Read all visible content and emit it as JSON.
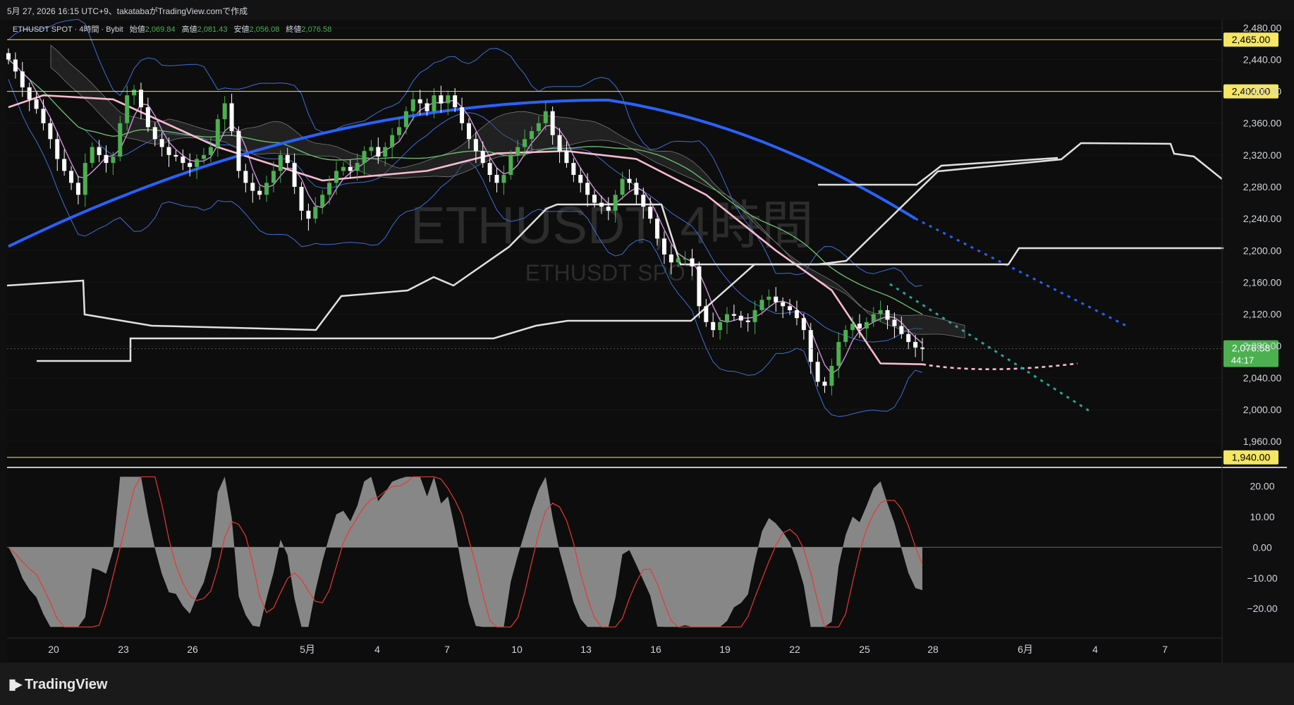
{
  "header": {
    "caption": "5月 27, 2026 16:15 UTC+9、takatabaがTradingView.comで作成"
  },
  "legend": {
    "symbol": "ETHUSDT SPOT · 4時間 · Bybit",
    "open_label": "始値",
    "open_value": "2,069.84",
    "high_label": "高値",
    "high_value": "2,081.43",
    "low_label": "安値",
    "low_value": "2,056.08",
    "close_label": "終値",
    "close_value": "2,076.58"
  },
  "watermark": {
    "title": "ETHUSDT, 4時間",
    "subtitle": "ETHUSDT SPOT"
  },
  "footer": {
    "brand": "TradingView"
  },
  "colors": {
    "up": "#26a69a",
    "up_bright": "#4caf50",
    "down": "#ffffff",
    "ma_blue": "#2962ff",
    "ma_pink": "#f8bbd0",
    "ma_green": "#66bb6a",
    "ma_purple": "#ce93d8",
    "bollinger": "#3d6fd6",
    "ichimoku": "#e0e0e0",
    "level_line": "#f5e663",
    "price_tag": "#4caf50",
    "oscillator": "#9e9e9e",
    "signal": "#e53935"
  },
  "chart_data": [
    {
      "type": "candlestick",
      "pane": "price",
      "ylim": [
        1930,
        2490
      ],
      "y_ticks": [
        "2,480.00",
        "2,440.00",
        "2,400.00",
        "2,360.00",
        "2,320.00",
        "2,280.00",
        "2,240.00",
        "2,200.00",
        "2,160.00",
        "2,120.00",
        "2,080.00",
        "2,040.00",
        "2,000.00",
        "1,960.00"
      ],
      "y_tick_values": [
        2480,
        2440,
        2400,
        2360,
        2320,
        2280,
        2240,
        2200,
        2160,
        2120,
        2080,
        2040,
        2000,
        1960
      ],
      "x_ticks": [
        "20",
        "23",
        "26",
        "5月",
        "4",
        "7",
        "10",
        "13",
        "16",
        "19",
        "22",
        "25",
        "28",
        "6月",
        "4",
        "7"
      ],
      "horizontal_levels": [
        {
          "value": 2465,
          "label": "2,465.00"
        },
        {
          "value": 2400,
          "label": "2,400.00"
        },
        {
          "value": 1940,
          "label": "1,940.00"
        }
      ],
      "current_price": {
        "value": 2076.58,
        "label": "2,076.58",
        "countdown": "44:17"
      },
      "closes": [
        2440,
        2425,
        2405,
        2390,
        2378,
        2360,
        2340,
        2315,
        2300,
        2285,
        2270,
        2310,
        2330,
        2320,
        2310,
        2318,
        2360,
        2395,
        2402,
        2380,
        2355,
        2340,
        2330,
        2320,
        2318,
        2310,
        2305,
        2315,
        2320,
        2330,
        2365,
        2385,
        2350,
        2300,
        2285,
        2275,
        2270,
        2285,
        2300,
        2320,
        2310,
        2280,
        2250,
        2240,
        2255,
        2270,
        2285,
        2300,
        2305,
        2300,
        2310,
        2325,
        2330,
        2318,
        2330,
        2345,
        2355,
        2375,
        2390,
        2385,
        2375,
        2395,
        2385,
        2395,
        2380,
        2360,
        2340,
        2325,
        2310,
        2295,
        2285,
        2295,
        2320,
        2330,
        2340,
        2350,
        2360,
        2375,
        2345,
        2325,
        2310,
        2295,
        2285,
        2270,
        2260,
        2255,
        2250,
        2270,
        2290,
        2285,
        2270,
        2255,
        2240,
        2215,
        2195,
        2185,
        2190,
        2190,
        2180,
        2130,
        2110,
        2100,
        2110,
        2120,
        2118,
        2112,
        2110,
        2125,
        2138,
        2142,
        2135,
        2130,
        2125,
        2115,
        2100,
        2060,
        2035,
        2030,
        2055,
        2085,
        2100,
        2108,
        2102,
        2110,
        2120,
        2125,
        2113,
        2105,
        2095,
        2085,
        2078,
        2076
      ],
      "ma_blue": {
        "from": [
          0,
          2205
        ],
        "peak": [
          86,
          2389
        ],
        "to": [
          130,
          2240
        ],
        "projection_to": [
          2365,
          2105
        ]
      },
      "ma_pink_points": [
        [
          0,
          2380
        ],
        [
          5,
          2395
        ],
        [
          15,
          2390
        ],
        [
          30,
          2330
        ],
        [
          45,
          2288
        ],
        [
          60,
          2300
        ],
        [
          70,
          2322
        ],
        [
          80,
          2325
        ],
        [
          90,
          2315
        ],
        [
          100,
          2270
        ],
        [
          110,
          2200
        ],
        [
          118,
          2150
        ],
        [
          125,
          2058
        ],
        [
          131,
          2057
        ]
      ],
      "oscillator": {
        "ylim": [
          -28,
          24
        ],
        "y_ticks": [
          "20.00",
          "10.00",
          "0.00",
          "−10.00",
          "−20.00"
        ],
        "y_tick_values": [
          20,
          10,
          0,
          -10,
          -20
        ]
      }
    }
  ]
}
